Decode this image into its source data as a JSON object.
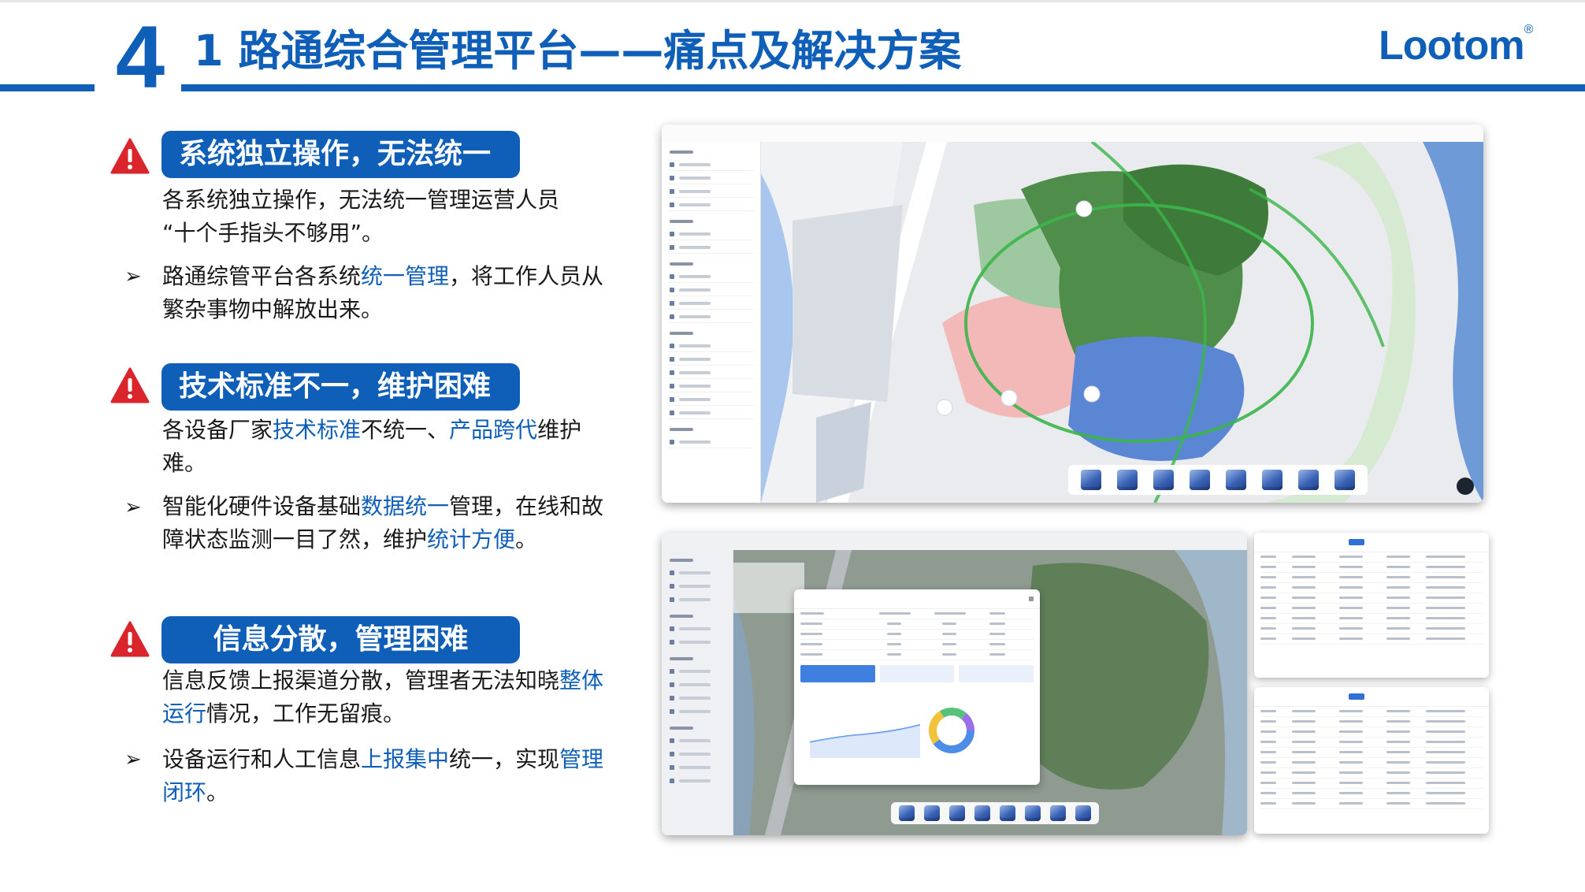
{
  "header": {
    "section_number": "4",
    "title": "1 路通综合管理平台——痛点及解决方案",
    "logo_text": "Lootom",
    "logo_mark": "®"
  },
  "blocks": [
    {
      "tag": "系统独立操作，无法统一",
      "problem": [
        "各系统独立操作，无法统一管理运营人员",
        "“十个手指头不够用”。"
      ],
      "solution_parts": [
        {
          "text": "路通综管平台各系统",
          "hl": false
        },
        {
          "text": "统一管理",
          "hl": true
        },
        {
          "text": "，将工作人员从繁杂事物中解放出来。",
          "hl": false
        }
      ]
    },
    {
      "tag": "技术标准不一，维护困难",
      "problem_parts": [
        {
          "text": "各设备厂家",
          "hl": false
        },
        {
          "text": "技术标准",
          "hl": true
        },
        {
          "text": "不统一、",
          "hl": false
        },
        {
          "text": "产品跨代",
          "hl": true
        },
        {
          "text": "维护难。",
          "hl": false
        }
      ],
      "solution_parts": [
        {
          "text": "智能化硬件设备基础",
          "hl": false
        },
        {
          "text": "数据统一",
          "hl": true
        },
        {
          "text": "管理，在线和故障状态监测一目了然，维护",
          "hl": false
        },
        {
          "text": "统计方便",
          "hl": true
        },
        {
          "text": "。",
          "hl": false
        }
      ]
    },
    {
      "tag": "信息分散，管理困难",
      "problem_parts": [
        {
          "text": "信息反馈上报渠道分散，管理者无法知晓",
          "hl": false
        },
        {
          "text": "整体运行",
          "hl": true
        },
        {
          "text": "情况，工作无留痕。",
          "hl": false
        }
      ],
      "solution_parts": [
        {
          "text": "设备运行和人工信息",
          "hl": false
        },
        {
          "text": "上报集中",
          "hl": true
        },
        {
          "text": "统一，实现",
          "hl": false
        },
        {
          "text": "管理闭环",
          "hl": true
        },
        {
          "text": "。",
          "hl": false
        }
      ]
    }
  ],
  "icons": {
    "warning": "warning-triangle-icon",
    "bullet": "arrow-bullet-icon"
  },
  "colors": {
    "brand_blue": "#0f5fb8",
    "warning_red": "#d9252b"
  }
}
